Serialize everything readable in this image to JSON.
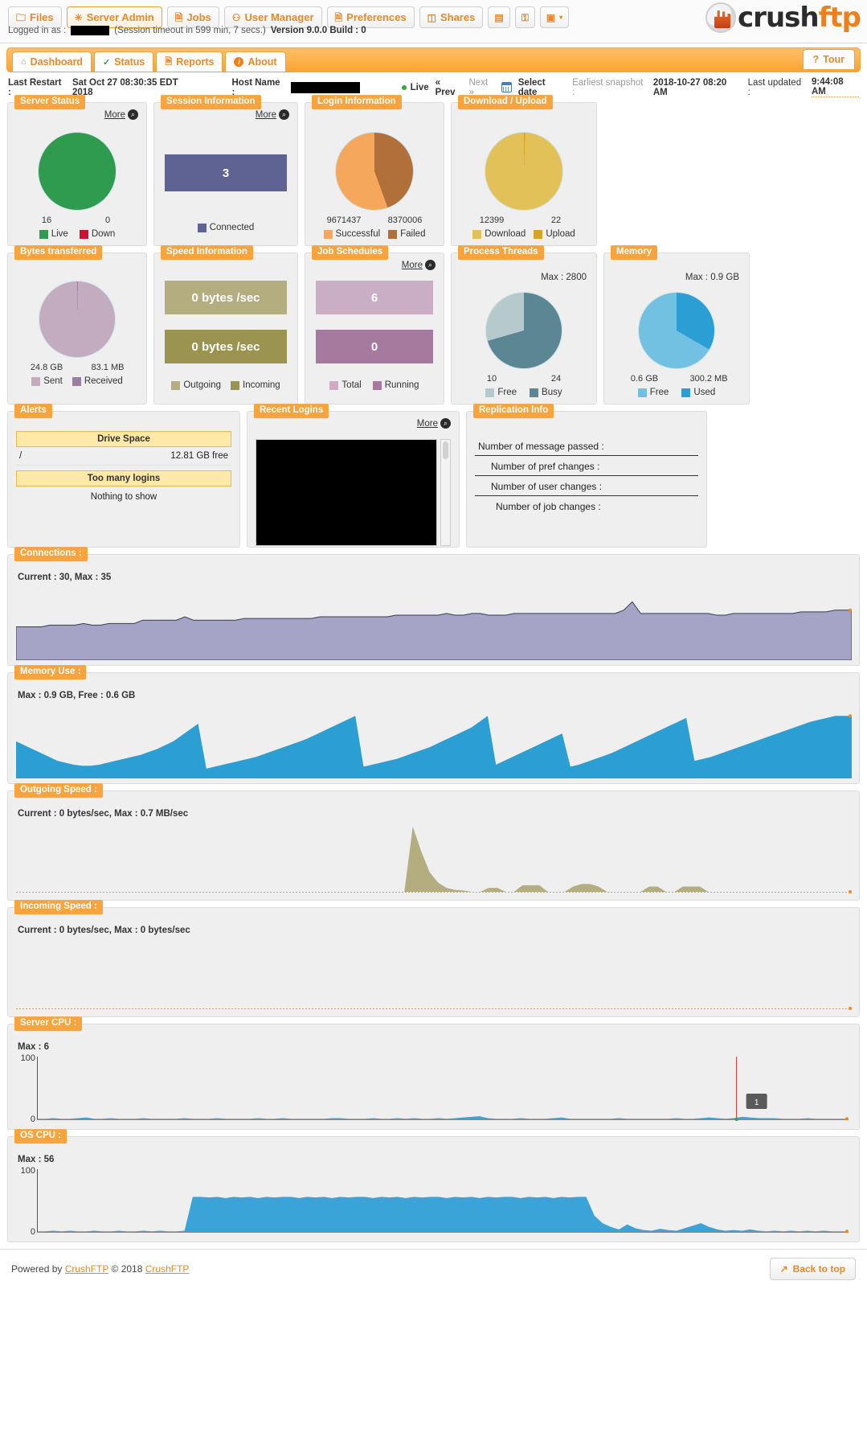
{
  "toolbar": {
    "buttons": [
      {
        "label": "Files",
        "icon": "folder-icon"
      },
      {
        "label": "Server Admin",
        "icon": "gear-icon"
      },
      {
        "label": "Jobs",
        "icon": "clipboard-icon"
      },
      {
        "label": "User Manager",
        "icon": "user-icon"
      },
      {
        "label": "Preferences",
        "icon": "sliders-icon"
      },
      {
        "label": "Shares",
        "icon": "share-icon"
      }
    ],
    "icon_buttons": [
      {
        "name": "terminal-icon",
        "glyph": "▤"
      },
      {
        "name": "key-icon",
        "glyph": "⚿"
      },
      {
        "name": "image-dropdown-icon",
        "glyph": "▣"
      }
    ],
    "logo_text_1": "crush",
    "logo_text_2": "ftp"
  },
  "session": {
    "logged_in_prefix": "Logged in as :",
    "timeout": "(Session timeout in 599 min, 7 secs.)",
    "version": "Version 9.0.0 Build : 0"
  },
  "tabs": [
    {
      "label": "Dashboard",
      "icon": "home-icon",
      "active": true
    },
    {
      "label": "Status",
      "icon": "check-icon",
      "active": false
    },
    {
      "label": "Reports",
      "icon": "clipboard-icon",
      "active": false
    },
    {
      "label": "About",
      "icon": "info-icon",
      "active": false
    }
  ],
  "tour": {
    "label": "Tour",
    "icon": "question-icon"
  },
  "infostrip": {
    "last_restart_label": "Last Restart :",
    "last_restart_value": "Sat Oct 27 08:30:35 EDT 2018",
    "host_name_label": "Host Name :",
    "live": "Live",
    "prev": "« Prev",
    "next": "Next »",
    "select_date": "Select date",
    "earliest_snapshot_label": "Earliest snapshot :",
    "earliest_snapshot_value": "2018-10-27 08:20 AM",
    "last_updated_label": "Last updated :",
    "last_updated_value": "9:44:08 AM"
  },
  "panels": {
    "server_status": {
      "title": "Server Status",
      "more": "More",
      "values": [
        "16",
        "0"
      ],
      "legend": [
        {
          "label": "Live",
          "color": "#2e9b4e"
        },
        {
          "label": "Down",
          "color": "#cf1030"
        }
      ],
      "chart_data": {
        "type": "pie",
        "labels": [
          "Live",
          "Down"
        ],
        "values": [
          16,
          0
        ],
        "colors": [
          "#2e9b4e",
          "#cf1030"
        ]
      }
    },
    "session_information": {
      "title": "Session Information",
      "more": "More",
      "value": "3",
      "legend": [
        {
          "label": "Connected",
          "color": "#5e6394"
        }
      ],
      "chart_data": {
        "type": "bar",
        "categories": [
          "Connected"
        ],
        "values": [
          3
        ],
        "colors": [
          "#5e6394"
        ]
      }
    },
    "login_information": {
      "title": "Login Information",
      "values": [
        "9671437",
        "8370006"
      ],
      "legend": [
        {
          "label": "Successful",
          "color": "#f5a85c"
        },
        {
          "label": "Failed",
          "color": "#b1703a"
        }
      ],
      "chart_data": {
        "type": "pie",
        "labels": [
          "Successful",
          "Failed"
        ],
        "values": [
          9671437,
          8370006
        ],
        "colors": [
          "#f5a85c",
          "#b1703a"
        ]
      }
    },
    "download_upload": {
      "title": "Download / Upload",
      "values": [
        "12399",
        "22"
      ],
      "legend": [
        {
          "label": "Download",
          "color": "#e2c158"
        },
        {
          "label": "Upload",
          "color": "#d7a526"
        }
      ],
      "chart_data": {
        "type": "pie",
        "labels": [
          "Download",
          "Upload"
        ],
        "values": [
          12399,
          22
        ],
        "colors": [
          "#e2c158",
          "#d7a526"
        ]
      }
    },
    "bytes_transferred": {
      "title": "Bytes transferred",
      "values": [
        "24.8 GB",
        "83.1 MB"
      ],
      "legend": [
        {
          "label": "Sent",
          "color": "#c3abc0"
        },
        {
          "label": "Received",
          "color": "#9b7fa0"
        }
      ],
      "chart_data": {
        "type": "pie",
        "labels": [
          "Sent",
          "Received"
        ],
        "values": [
          24.8,
          0.0831
        ],
        "unit": "GB",
        "colors": [
          "#c3abc0",
          "#9b7fa0"
        ]
      }
    },
    "speed_information": {
      "title": "Speed Information",
      "outgoing_value": "0 bytes /sec",
      "incoming_value": "0 bytes /sec",
      "legend": [
        {
          "label": "Outgoing",
          "color": "#b3ad80"
        },
        {
          "label": "Incoming",
          "color": "#9a9450"
        }
      ]
    },
    "job_schedules": {
      "title": "Job Schedules",
      "more": "More",
      "total_value": "6",
      "running_value": "0",
      "legend": [
        {
          "label": "Total",
          "color": "#c9aec5"
        },
        {
          "label": "Running",
          "color": "#a57a9e"
        }
      ]
    },
    "process_threads": {
      "title": "Process Threads",
      "max_label": "Max : 2800",
      "values": [
        "10",
        "24"
      ],
      "legend": [
        {
          "label": "Free",
          "color": "#b6c9cd"
        },
        {
          "label": "Busy",
          "color": "#5b8794"
        }
      ],
      "chart_data": {
        "type": "pie",
        "labels": [
          "Free",
          "Busy"
        ],
        "values": [
          10,
          24
        ],
        "colors": [
          "#b6c9cd",
          "#5b8794"
        ]
      }
    },
    "memory": {
      "title": "Memory",
      "max_label": "Max : 0.9 GB",
      "values": [
        "0.6 GB",
        "300.2 MB"
      ],
      "legend": [
        {
          "label": "Free",
          "color": "#72c0e2"
        },
        {
          "label": "Used",
          "color": "#2b9fd4"
        }
      ],
      "chart_data": {
        "type": "pie",
        "labels": [
          "Free",
          "Used"
        ],
        "values": [
          0.6,
          0.3002
        ],
        "unit": "GB",
        "colors": [
          "#72c0e2",
          "#2b9fd4"
        ]
      }
    },
    "alerts": {
      "title": "Alerts",
      "drive_space_header": "Drive Space",
      "drive_path": "/",
      "drive_free": "12.81 GB free",
      "too_many_logins_header": "Too many logins",
      "nothing_to_show": "Nothing to show"
    },
    "recent_logins": {
      "title": "Recent Logins",
      "more": "More"
    },
    "replication_info": {
      "title": "Replication Info",
      "lines": [
        "Number of message passed :",
        "Number of pref changes :",
        "Number of user changes :",
        "Number of job changes :"
      ]
    }
  },
  "graphs": {
    "connections": {
      "title": "Connections :",
      "subtitle": "Current : 30, Max : 35",
      "chart_data": {
        "type": "area",
        "title": "Connections",
        "ylabel": "connections",
        "current": 30,
        "max": 35,
        "color": "#a5a4c6",
        "values": [
          20,
          20,
          20,
          20,
          21,
          21,
          21,
          21,
          22,
          21,
          21,
          22,
          22,
          22,
          22,
          24,
          24,
          24,
          24,
          24,
          26,
          24,
          24,
          24,
          24,
          24,
          24,
          25,
          25,
          25,
          25,
          25,
          25,
          25,
          25,
          25,
          26,
          26,
          26,
          26,
          26,
          26,
          26,
          26,
          26,
          27,
          27,
          27,
          27,
          27,
          27,
          28,
          27,
          27,
          28,
          28,
          27,
          27,
          27,
          28,
          28,
          28,
          28,
          28,
          28,
          28,
          28,
          28,
          28,
          28,
          28,
          28,
          30,
          35,
          28,
          28,
          28,
          28,
          28,
          28,
          28,
          28,
          28,
          27,
          27,
          28,
          28,
          28,
          28,
          28,
          28,
          28,
          28,
          29,
          29,
          29,
          29,
          30,
          30,
          30
        ]
      }
    },
    "memory_use": {
      "title": "Memory Use :",
      "subtitle": "Max : 0.9 GB, Free : 0.6 GB",
      "chart_data": {
        "type": "area",
        "title": "Memory Use",
        "max_gb": 0.9,
        "free_gb": 0.6,
        "color": "#2b9fd4",
        "values": [
          38,
          34,
          30,
          26,
          22,
          18,
          16,
          14,
          13,
          13,
          14,
          16,
          18,
          20,
          22,
          24,
          27,
          30,
          34,
          38,
          44,
          50,
          56,
          10,
          12,
          14,
          16,
          18,
          20,
          22,
          25,
          28,
          31,
          34,
          37,
          40,
          44,
          48,
          52,
          56,
          60,
          64,
          12,
          14,
          16,
          18,
          20,
          23,
          26,
          29,
          32,
          36,
          40,
          44,
          48,
          52,
          58,
          64,
          14,
          18,
          22,
          26,
          30,
          34,
          38,
          42,
          46,
          12,
          14,
          17,
          20,
          23,
          26,
          30,
          34,
          38,
          42,
          46,
          50,
          54,
          58,
          62,
          18,
          20,
          22,
          25,
          28,
          31,
          34,
          37,
          40,
          43,
          46,
          49,
          52,
          55,
          58,
          60,
          62,
          64,
          64,
          64
        ]
      }
    },
    "outgoing_speed": {
      "title": "Outgoing Speed :",
      "subtitle": "Current : 0 bytes/sec, Max : 0.7 MB/sec",
      "chart_data": {
        "type": "area",
        "title": "Outgoing Speed",
        "current": "0 bytes/sec",
        "max": "0.7 MB/sec",
        "color": "#b3ad80",
        "values": [
          0,
          0,
          0,
          0,
          0,
          0,
          0,
          0,
          0,
          0,
          0,
          0,
          0,
          0,
          0,
          0,
          0,
          0,
          0,
          0,
          0,
          0,
          0,
          0,
          0,
          0,
          0,
          0,
          0,
          0,
          0,
          0,
          0,
          0,
          0,
          0,
          0,
          0,
          0,
          0,
          0,
          0,
          0,
          0,
          0,
          0,
          0,
          100,
          62,
          30,
          14,
          6,
          3,
          2,
          0,
          0,
          6,
          6,
          0,
          0,
          10,
          10,
          10,
          0,
          0,
          0,
          8,
          12,
          12,
          8,
          0,
          0,
          0,
          0,
          0,
          8,
          8,
          0,
          0,
          8,
          8,
          8,
          0,
          0,
          0,
          0,
          0,
          0,
          0,
          0,
          0,
          0,
          0,
          0,
          0,
          0,
          0,
          0,
          0,
          0
        ]
      }
    },
    "incoming_speed": {
      "title": "Incoming Speed :",
      "subtitle": "Current : 0 bytes/sec, Max : 0 bytes/sec",
      "chart_data": {
        "type": "area",
        "title": "Incoming Speed",
        "current": "0 bytes/sec",
        "max": "0 bytes/sec",
        "color": "#b3ad80",
        "values": [
          0,
          0,
          0,
          0,
          0,
          0,
          0,
          0,
          0,
          0,
          0,
          0,
          0,
          0,
          0,
          0,
          0,
          0,
          0,
          0,
          0,
          0,
          0,
          0,
          0,
          0,
          0,
          0,
          0,
          0,
          0,
          0,
          0,
          0,
          0,
          0,
          0,
          0,
          0,
          0,
          0,
          0,
          0,
          0,
          0,
          0,
          0,
          0,
          0,
          0
        ]
      }
    },
    "server_cpu": {
      "title": "Server CPU :",
      "subtitle": "Max : 6",
      "y_top": "100",
      "y_bottom": "0",
      "tooltip": "1",
      "chart_data": {
        "type": "area",
        "title": "Server CPU",
        "max": 6,
        "ylim": [
          0,
          100
        ],
        "color": "#3aa3d8",
        "values": [
          1,
          1,
          2,
          1,
          1,
          2,
          3,
          1,
          1,
          2,
          1,
          1,
          1,
          2,
          1,
          1,
          1,
          1,
          2,
          1,
          1,
          1,
          2,
          1,
          1,
          1,
          1,
          2,
          1,
          1,
          2,
          1,
          1,
          1,
          1,
          1,
          2,
          2,
          1,
          1,
          1,
          2,
          1,
          1,
          2,
          1,
          2,
          1,
          1,
          2,
          1,
          2,
          3,
          4,
          5,
          2,
          1,
          1,
          1,
          2,
          1,
          1,
          1,
          2,
          3,
          1,
          1,
          1,
          1,
          1,
          1,
          2,
          1,
          1,
          1,
          1,
          1,
          1,
          2,
          1,
          1,
          2,
          3,
          2,
          1,
          2,
          4,
          3,
          2,
          2,
          2,
          1,
          1,
          1,
          2,
          1,
          1,
          1,
          1,
          1
        ]
      }
    },
    "os_cpu": {
      "title": "OS CPU :",
      "subtitle": "Max : 56",
      "y_top": "100",
      "y_bottom": "0",
      "chart_data": {
        "type": "area",
        "title": "OS CPU",
        "max": 56,
        "ylim": [
          0,
          100
        ],
        "color": "#3aa3d8",
        "values": [
          1,
          1,
          2,
          1,
          2,
          1,
          1,
          2,
          1,
          1,
          2,
          1,
          1,
          2,
          1,
          2,
          1,
          1,
          2,
          56,
          56,
          55,
          56,
          54,
          56,
          55,
          56,
          54,
          56,
          55,
          56,
          56,
          54,
          56,
          55,
          56,
          54,
          56,
          55,
          56,
          56,
          54,
          56,
          55,
          56,
          54,
          56,
          55,
          56,
          56,
          54,
          56,
          55,
          56,
          54,
          56,
          55,
          56,
          56,
          54,
          56,
          55,
          56,
          54,
          56,
          55,
          56,
          56,
          26,
          14,
          8,
          4,
          12,
          6,
          3,
          2,
          5,
          3,
          2,
          6,
          10,
          14,
          8,
          4,
          2,
          3,
          2,
          4,
          2,
          1,
          2,
          1,
          2,
          1,
          2,
          1,
          2,
          1,
          1,
          1
        ]
      }
    }
  },
  "footer": {
    "powered_by": "Powered by",
    "link1": "CrushFTP",
    "copyright": "© 2018",
    "link2": "CrushFTP",
    "back_to_top": "Back to top"
  }
}
